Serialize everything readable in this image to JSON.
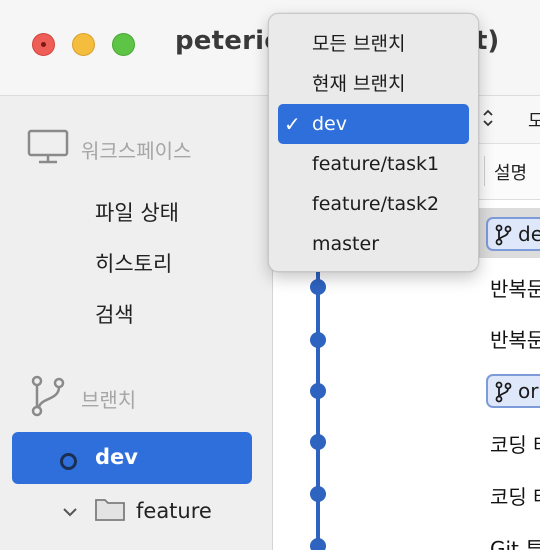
{
  "window": {
    "title": "peteric",
    "title_tail": "t)"
  },
  "sidebar": {
    "workspace_header": "워크스페이스",
    "items": [
      {
        "label": "파일 상태"
      },
      {
        "label": "히스토리"
      },
      {
        "label": "검색"
      }
    ],
    "branches_header": "브랜치",
    "current_branch": "dev",
    "folder": "feature"
  },
  "toolbar": {
    "right_text": "모"
  },
  "columns": {
    "description": "설명"
  },
  "commits": [
    {
      "badge": "dev"
    },
    {
      "message": "반복문"
    },
    {
      "message": "반복문"
    },
    {
      "badge": "origin"
    },
    {
      "message": "코딩 테"
    },
    {
      "message": "코딩 테"
    },
    {
      "message": "Git 튜"
    }
  ],
  "dropdown": {
    "options": [
      {
        "label": "모든 브랜치",
        "selected": false
      },
      {
        "label": "현재 브랜치",
        "selected": false
      },
      {
        "label": "dev",
        "selected": true
      },
      {
        "label": "feature/task1",
        "selected": false
      },
      {
        "label": "feature/task2",
        "selected": false
      },
      {
        "label": "master",
        "selected": false
      }
    ],
    "check_glyph": "✓"
  },
  "colors": {
    "accent": "#2f6fdc",
    "graph": "#2e63c0",
    "close": "#ee5e57",
    "minimize": "#f5bd3e",
    "zoom": "#5ec445"
  }
}
